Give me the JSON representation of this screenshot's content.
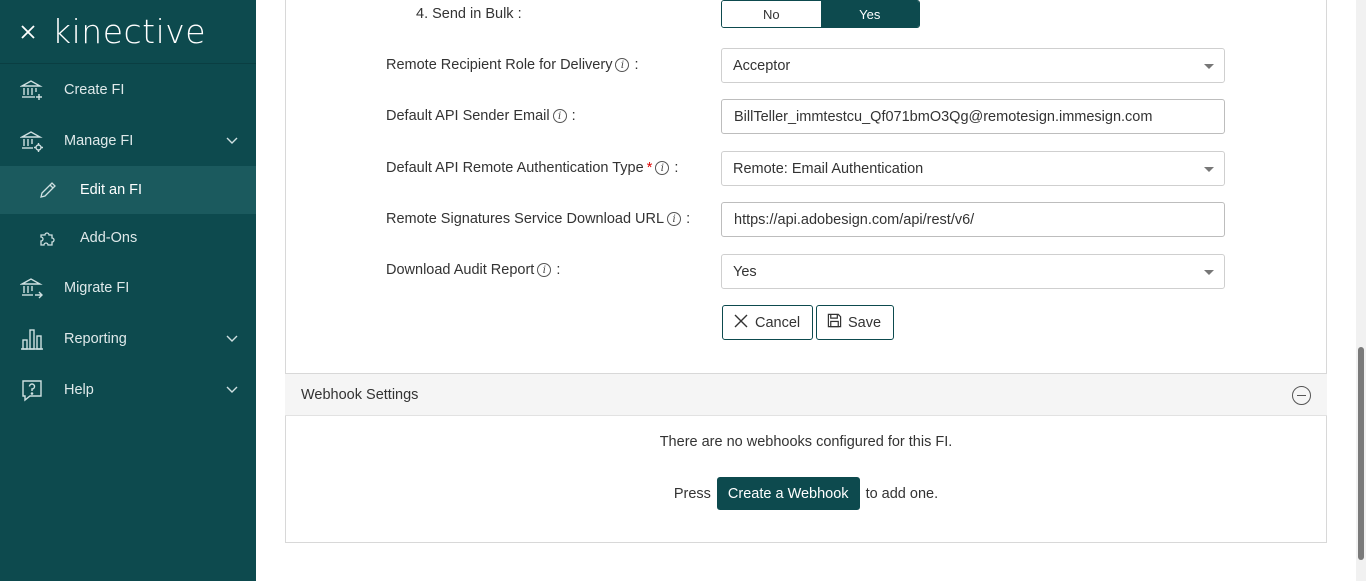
{
  "sidebar": {
    "logo": "kinective",
    "items": [
      {
        "label": "Create FI"
      },
      {
        "label": "Manage FI"
      },
      {
        "label": "Edit an FI"
      },
      {
        "label": "Add-Ons"
      },
      {
        "label": "Migrate FI"
      },
      {
        "label": "Reporting"
      },
      {
        "label": "Help"
      }
    ]
  },
  "form": {
    "send_bulk": {
      "label": "4. Send in Bulk :",
      "no": "No",
      "yes": "Yes",
      "selected": "Yes"
    },
    "recipient_role": {
      "label": "Remote Recipient Role for Delivery",
      "suffix": ":",
      "value": "Acceptor"
    },
    "sender_email": {
      "label": "Default API Sender Email",
      "suffix": ":",
      "value": "BillTeller_immtestcu_Qf071bmO3Qg@remotesign.immesign.com"
    },
    "auth_type": {
      "label": "Default API Remote Authentication Type",
      "required": "*",
      "suffix": ":",
      "value": "Remote: Email Authentication"
    },
    "download_url": {
      "label": "Remote Signatures Service Download URL",
      "suffix": ":",
      "value": "https://api.adobesign.com/api/rest/v6/"
    },
    "audit_report": {
      "label": "Download Audit Report",
      "suffix": ":",
      "value": "Yes"
    },
    "info_glyph": "i",
    "cancel_label": "Cancel",
    "save_label": "Save"
  },
  "webhooks": {
    "title": "Webhook Settings",
    "empty_text": "There are no webhooks configured for this FI.",
    "press": "Press",
    "create_label": "Create a Webhook",
    "to_add": "to add one."
  },
  "colors": {
    "brand": "#0d4a4e",
    "required": "#d00000"
  }
}
